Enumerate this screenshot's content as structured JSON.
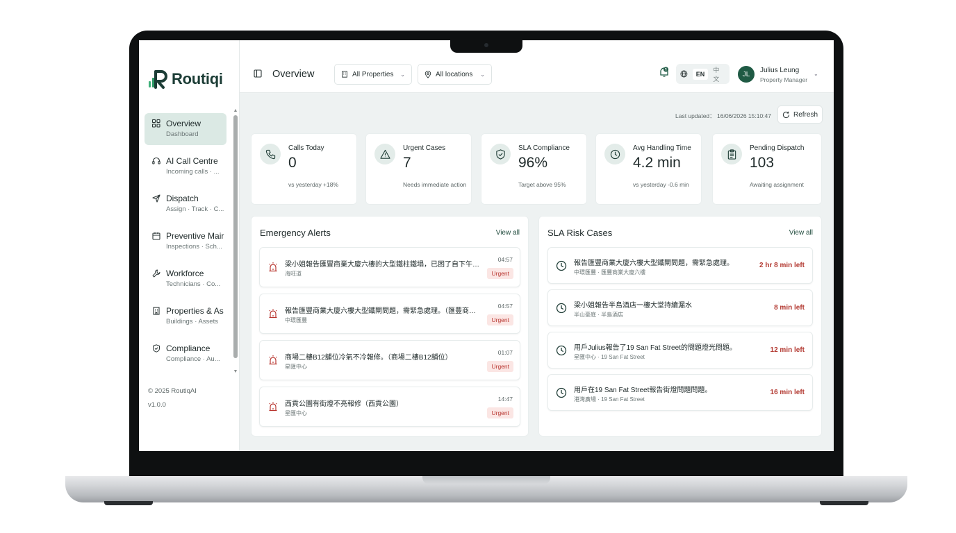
{
  "brand": {
    "name": "Routiqi",
    "accent": "#1f5a44",
    "urgent_color": "#b8352f"
  },
  "sidebar": {
    "items": [
      {
        "label": "Overview",
        "sub": "Dashboard",
        "icon": "grid-icon",
        "active": true
      },
      {
        "label": "AI Call Centre",
        "sub": "Incoming calls · ...",
        "icon": "headset-icon"
      },
      {
        "label": "Dispatch",
        "sub": "Assign · Track · C...",
        "icon": "send-icon"
      },
      {
        "label": "Preventive Mair",
        "sub": "Inspections · Sch...",
        "icon": "calendar-icon"
      },
      {
        "label": "Workforce",
        "sub": "Technicians · Co...",
        "icon": "wrench-icon"
      },
      {
        "label": "Properties & As",
        "sub": "Buildings · Assets",
        "icon": "building-icon"
      },
      {
        "label": "Compliance",
        "sub": "Compliance · Au...",
        "icon": "shield-icon"
      }
    ],
    "copyright": "© 2025 RoutiqAI",
    "version": "v1.0.0"
  },
  "header": {
    "title": "Overview",
    "properties_filter": "All Properties",
    "locations_filter": "All locations",
    "lang_en": "EN",
    "lang_zh": "中文",
    "user": {
      "initials": "JL",
      "name": "Julius Leung",
      "role": "Property Manager"
    }
  },
  "main": {
    "last_updated": "Last updated： 16/06/2026 15:10:47",
    "refresh_label": "Refresh",
    "stats": [
      {
        "title": "Calls Today",
        "value": "0",
        "note": "vs yesterday +18%",
        "icon": "phone-icon"
      },
      {
        "title": "Urgent Cases",
        "value": "7",
        "note": "Needs immediate action",
        "icon": "warning-icon"
      },
      {
        "title": "SLA Compliance",
        "value": "96%",
        "note": "Target above 95%",
        "icon": "shield-check-icon"
      },
      {
        "title": "Avg Handling Time",
        "value": "4.2 min",
        "note": "vs yesterday -0.6 min",
        "icon": "clock-icon"
      },
      {
        "title": "Pending Dispatch",
        "value": "103",
        "note": "Awaiting assignment",
        "icon": "clipboard-icon"
      }
    ],
    "alerts": {
      "title": "Emergency Alerts",
      "view_all": "View all",
      "items": [
        {
          "title": "梁小姐報告匯豐商業大廈六樓的大型鐵柱鐵塌，已困了自下午三時起...",
          "location": "海旺道",
          "time": "04:57",
          "badge": "Urgent"
        },
        {
          "title": "報告匯豐商業大廈六樓大型鐵閘問題，需緊急處理。（匯豐商業大廈...",
          "location": "中環匯豐",
          "time": "04:57",
          "badge": "Urgent"
        },
        {
          "title": "商場二樓B12舖位冷氣不冷報修。（商場二樓B12舖位）",
          "location": "星匯中心",
          "time": "01:07",
          "badge": "Urgent"
        },
        {
          "title": "西貢公園有街燈不亮報修（西貢公園）",
          "location": "星匯中心",
          "time": "14:47",
          "badge": "Urgent"
        }
      ]
    },
    "sla": {
      "title": "SLA Risk Cases",
      "view_all": "View all",
      "items": [
        {
          "title": "報告匯豐商業大廈六樓大型鐵閘問題，需緊急處理。",
          "location": "中環匯豐 · 匯豐商業大廈六樓",
          "left": "2 hr 8 min left"
        },
        {
          "title": "梁小姐報告半島酒店一樓大堂持續漏水",
          "location": "半山豪庭 · 半島酒店",
          "left": "8 min left"
        },
        {
          "title": "用戶Julius報告了19 San Fat Street的問題燈光問題。",
          "location": "星匯中心 · 19 San Fat Street",
          "left": "12 min left"
        },
        {
          "title": "用戶在19 San Fat Street報告街燈問題問題。",
          "location": "港灣廣場 · 19 San Fat Street",
          "left": "16 min left"
        }
      ]
    }
  }
}
